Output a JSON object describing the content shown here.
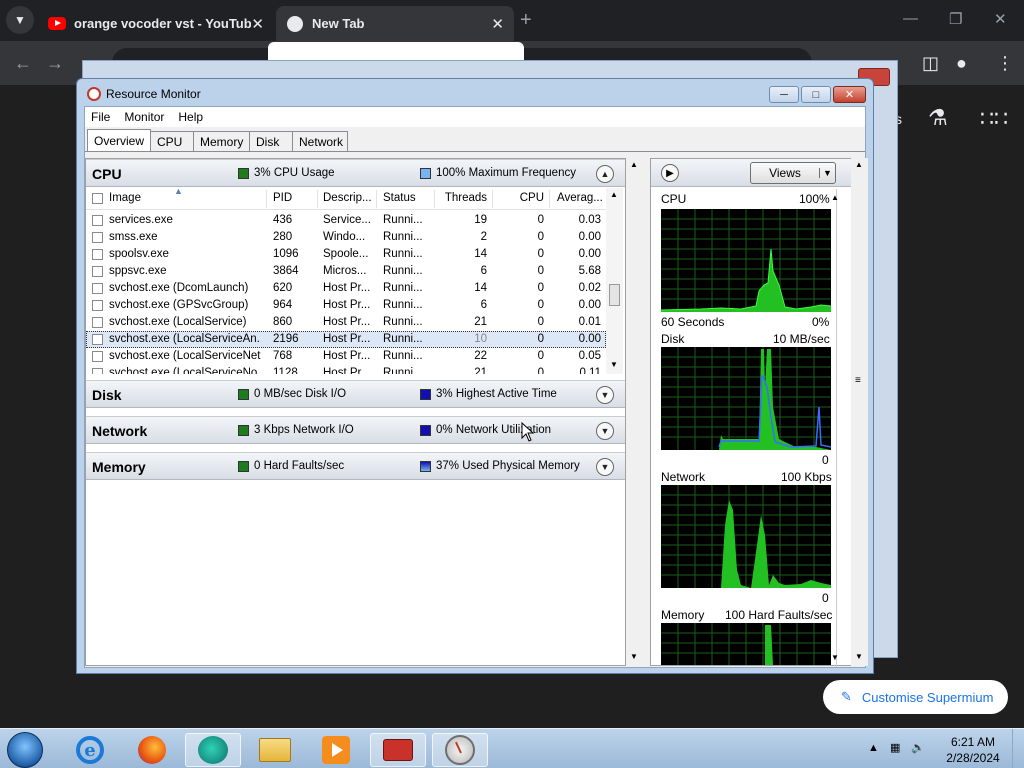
{
  "browser": {
    "tabs": [
      {
        "title": "orange vocoder vst - YouTube",
        "icon": "youtube-icon"
      },
      {
        "title": "New Tab",
        "icon": "globe-icon"
      }
    ],
    "page": {
      "customise_button": "Customise Supermium"
    }
  },
  "resmon": {
    "title": "Resource Monitor",
    "menu": [
      "File",
      "Monitor",
      "Help"
    ],
    "tabs": [
      "Overview",
      "CPU",
      "Memory",
      "Disk",
      "Network"
    ],
    "cpu": {
      "title": "CPU",
      "usage": "3% CPU Usage",
      "frequency": "100% Maximum Frequency",
      "columns": [
        "Image",
        "PID",
        "Descrip...",
        "Status",
        "Threads",
        "CPU",
        "Averag..."
      ],
      "rows": [
        [
          "services.exe",
          "436",
          "Service...",
          "Runni...",
          "19",
          "0",
          "0.03"
        ],
        [
          "smss.exe",
          "280",
          "Windo...",
          "Runni...",
          "2",
          "0",
          "0.00"
        ],
        [
          "spoolsv.exe",
          "1096",
          "Spoole...",
          "Runni...",
          "14",
          "0",
          "0.00"
        ],
        [
          "sppsvc.exe",
          "3864",
          "Micros...",
          "Runni...",
          "6",
          "0",
          "5.68"
        ],
        [
          "svchost.exe (DcomLaunch)",
          "620",
          "Host Pr...",
          "Runni...",
          "14",
          "0",
          "0.02"
        ],
        [
          "svchost.exe (GPSvcGroup)",
          "964",
          "Host Pr...",
          "Runni...",
          "6",
          "0",
          "0.00"
        ],
        [
          "svchost.exe (LocalService)",
          "860",
          "Host Pr...",
          "Runni...",
          "21",
          "0",
          "0.01"
        ],
        [
          "svchost.exe (LocalServiceAn...",
          "2196",
          "Host Pr...",
          "Runni...",
          "10",
          "0",
          "0.00"
        ],
        [
          "svchost.exe (LocalServiceNet...",
          "768",
          "Host Pr...",
          "Runni...",
          "22",
          "0",
          "0.05"
        ],
        [
          "svchost.exe (LocalServiceNo...",
          "1128",
          "Host Pr...",
          "Runni...",
          "21",
          "0",
          "0.11"
        ]
      ],
      "selected_row": 7
    },
    "disk": {
      "title": "Disk",
      "io": "0 MB/sec Disk I/O",
      "active": "3% Highest Active Time"
    },
    "network": {
      "title": "Network",
      "io": "3 Kbps Network I/O",
      "util": "0% Network Utilization"
    },
    "memory": {
      "title": "Memory",
      "faults": "0 Hard Faults/sec",
      "used": "37% Used Physical Memory"
    },
    "colors": {
      "green_box": "#1e7b1e",
      "blue_box": "#1010b0",
      "light_blue_box": "#78b4f0"
    },
    "views_button": "Views",
    "graphs": [
      {
        "name": "CPU",
        "max": "100%",
        "footer_left": "60 Seconds",
        "footer_right": "0%"
      },
      {
        "name": "Disk",
        "max": "10 MB/sec",
        "footer_right": "0"
      },
      {
        "name": "Network",
        "max": "100 Kbps",
        "footer_right": "0"
      },
      {
        "name": "Memory",
        "max": "100 Hard Faults/sec"
      }
    ]
  },
  "taskbar": {
    "time": "6:21 AM",
    "date": "2/28/2024"
  }
}
